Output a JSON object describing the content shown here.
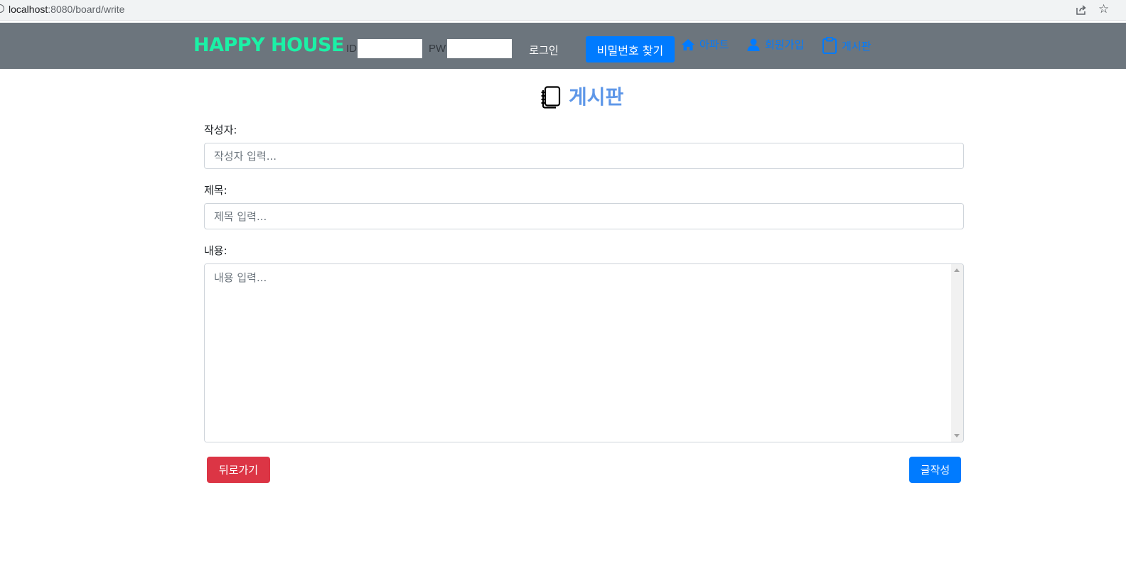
{
  "browser": {
    "host": "localhost",
    "path": ":8080/board/write"
  },
  "navbar": {
    "brand": "HAPPY HOUSE",
    "id_label": "ID",
    "pw_label": "PW",
    "login_label": "로그인",
    "find_password_label": "비밀번호 찾기",
    "links": [
      {
        "label": "아파트",
        "icon": "home-icon"
      },
      {
        "label": "회원가입",
        "icon": "user-icon"
      },
      {
        "label": "게시판",
        "icon": "clipboard-icon"
      }
    ]
  },
  "page": {
    "title": "게시판",
    "title_icon": "notebook-icon"
  },
  "form": {
    "writer_label": "작성자:",
    "writer_placeholder": "작성자 입력...",
    "subject_label": "제목:",
    "subject_placeholder": "제목 입력...",
    "content_label": "내용:",
    "content_placeholder": "내용 입력...",
    "back_label": "뒤로가기",
    "submit_label": "글작성"
  },
  "colors": {
    "navbar_bg": "#6c757d",
    "brand": "#1bf1a6",
    "primary": "#007bff",
    "danger": "#dc3545",
    "title": "#5e97e8"
  }
}
